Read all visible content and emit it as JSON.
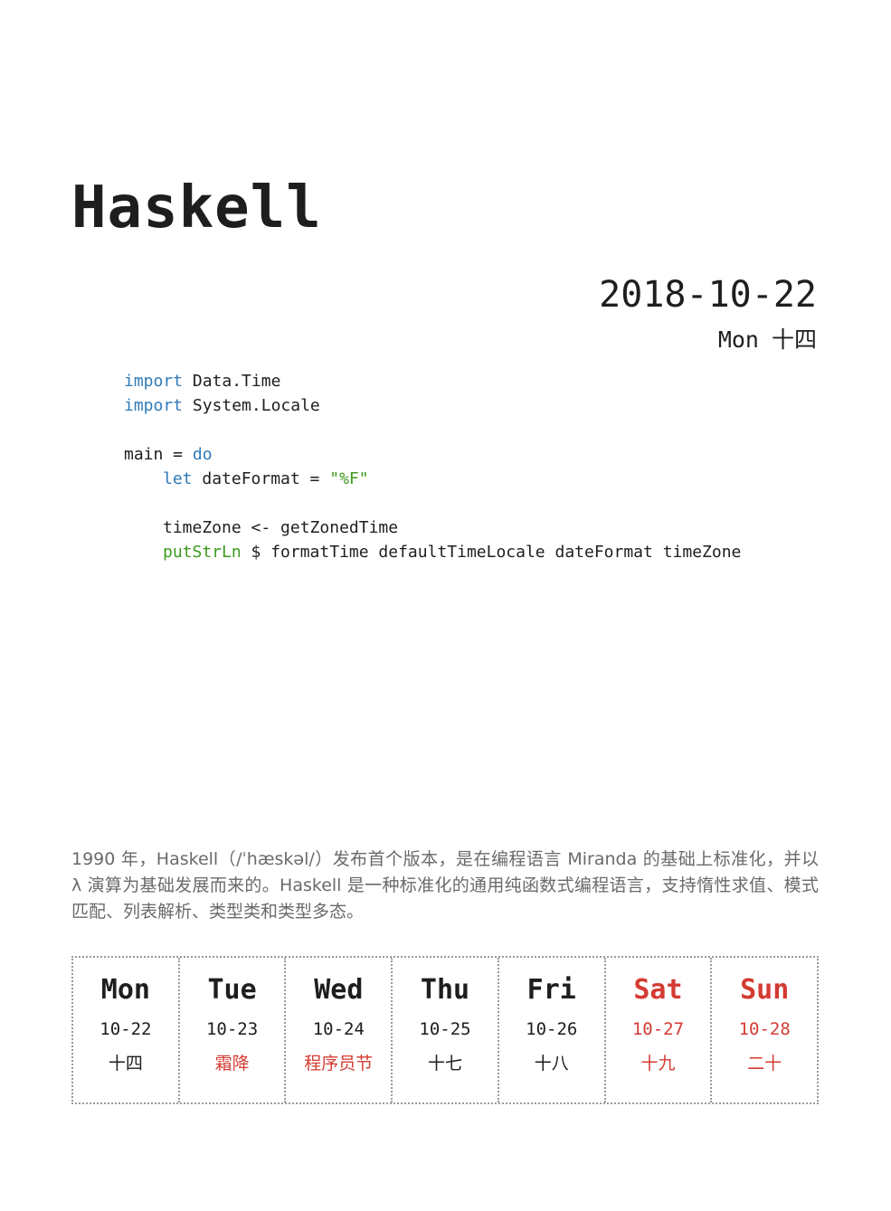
{
  "title": "Haskell",
  "date": {
    "full": "2018-10-22",
    "weekday": "Mon",
    "lunar": "十四"
  },
  "code": {
    "l1": {
      "kw": "import",
      "rest": " Data.Time"
    },
    "l2": {
      "kw": "import",
      "rest": " System.Locale"
    },
    "l3": {
      "pre": "main = ",
      "kw": "do"
    },
    "l4": {
      "kw": "let",
      "mid": " dateFormat = ",
      "str": "\"%F\""
    },
    "l5": {
      "text": "timeZone <- getZonedTime"
    },
    "l6": {
      "fn": "putStrLn",
      "rest": " $ formatTime defaultTimeLocale dateFormat timeZone"
    }
  },
  "description": "1990 年，Haskell（/ˈhæskəl/）发布首个版本，是在编程语言 Miranda 的基础上标准化，并以 λ 演算为基础发展而来的。Haskell 是一种标准化的通用纯函数式编程语言，支持惰性求值、模式匹配、列表解析、类型类和类型多态。",
  "week": [
    {
      "name": "Mon",
      "date": "10-22",
      "lunar": "十四"
    },
    {
      "name": "Tue",
      "date": "10-23",
      "lunar": "霜降"
    },
    {
      "name": "Wed",
      "date": "10-24",
      "lunar": "程序员节"
    },
    {
      "name": "Thu",
      "date": "10-25",
      "lunar": "十七"
    },
    {
      "name": "Fri",
      "date": "10-26",
      "lunar": "十八"
    },
    {
      "name": "Sat",
      "date": "10-27",
      "lunar": "十九"
    },
    {
      "name": "Sun",
      "date": "10-28",
      "lunar": "二十"
    }
  ],
  "colors": {
    "text": "#1e1e1e",
    "keyword": "#2f7ab8",
    "string": "#3c9a1e",
    "holiday": "#d43b32",
    "muted": "#6a6a6a"
  }
}
